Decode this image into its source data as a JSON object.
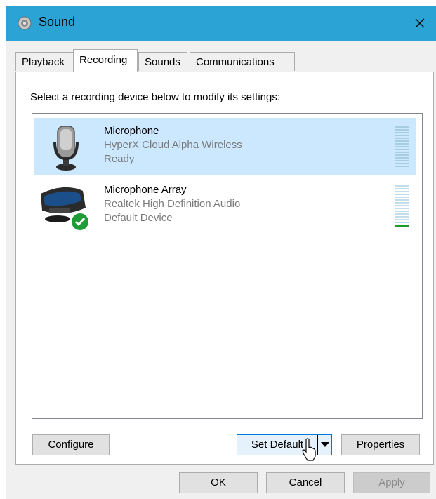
{
  "window": {
    "title": "Sound",
    "title_icon": "speaker-icon",
    "close_icon": "close-icon"
  },
  "tabs": [
    {
      "label": "Playback",
      "active": false
    },
    {
      "label": "Recording",
      "active": true
    },
    {
      "label": "Sounds",
      "active": false
    },
    {
      "label": "Communications",
      "active": false
    }
  ],
  "panel": {
    "instruction": "Select a recording device below to modify its settings:",
    "devices": [
      {
        "name": "Microphone",
        "description": "HyperX Cloud Alpha Wireless",
        "status": "Ready",
        "selected": true,
        "icon": "headset-microphone-icon",
        "default_badge": false,
        "level": 0
      },
      {
        "name": "Microphone Array",
        "description": "Realtek High Definition Audio",
        "status": "Default Device",
        "selected": false,
        "icon": "webcam-microphone-icon",
        "default_badge": true,
        "level": 0.07
      }
    ],
    "buttons": {
      "configure": "Configure",
      "set_default": "Set Default",
      "properties": "Properties"
    }
  },
  "footer": {
    "ok": "OK",
    "cancel": "Cancel",
    "apply": "Apply"
  },
  "colors": {
    "title_bar": "#2ba3d5",
    "selection": "#cce8ff",
    "default_check": "#1e9d36",
    "focus_border": "#0078d7"
  }
}
